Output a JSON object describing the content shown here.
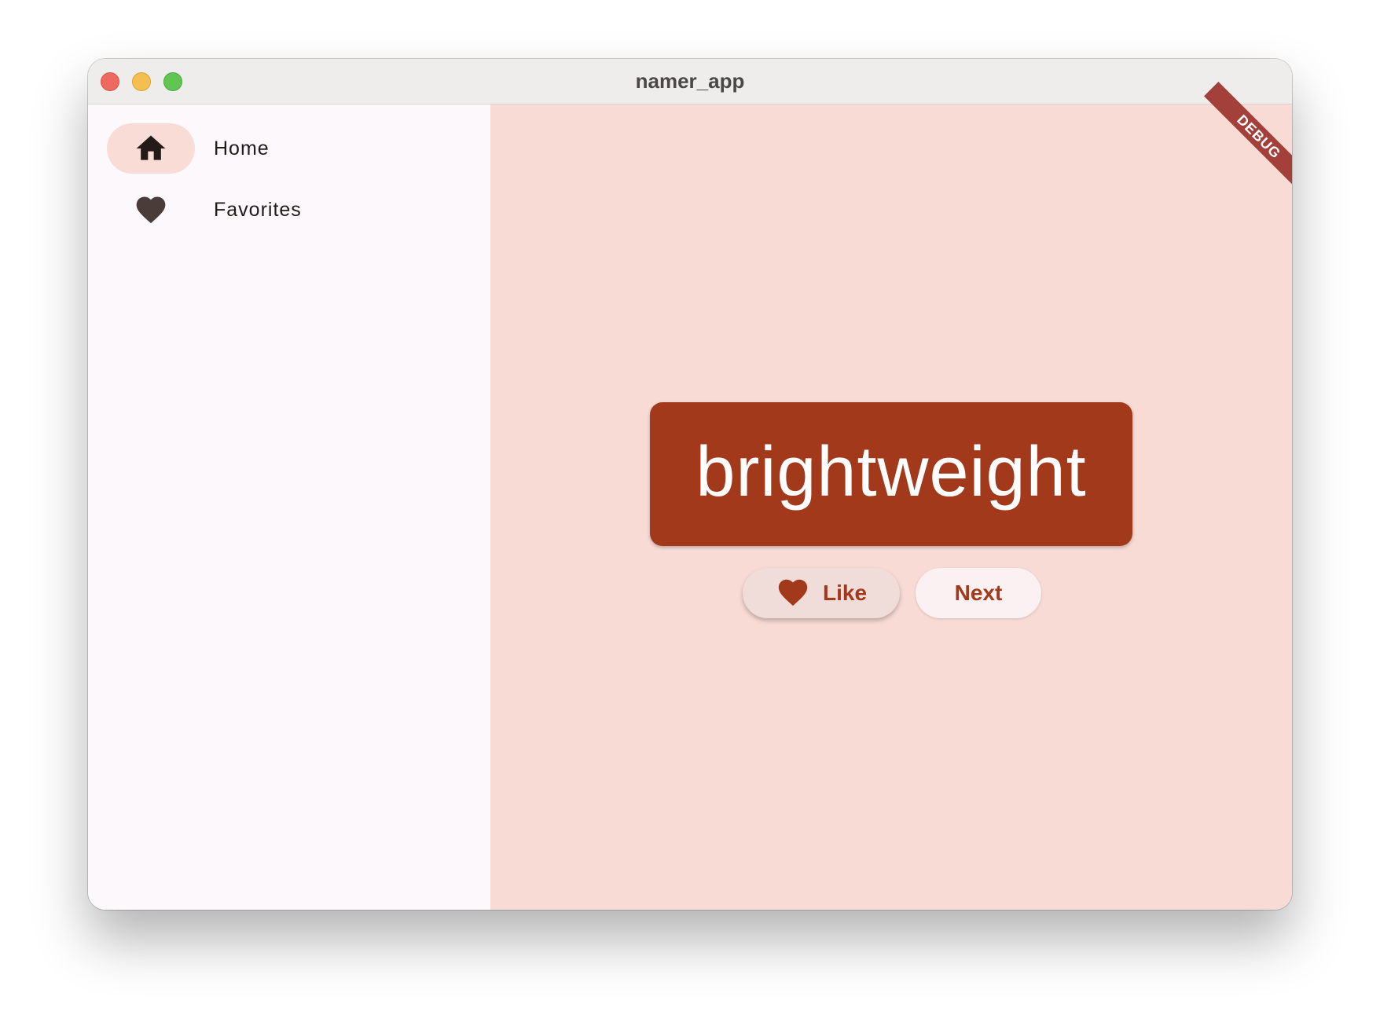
{
  "window": {
    "title": "namer_app"
  },
  "sidebar": {
    "items": [
      {
        "label": "Home",
        "icon": "home-icon",
        "selected": true
      },
      {
        "label": "Favorites",
        "icon": "heart-icon",
        "selected": false
      }
    ]
  },
  "main": {
    "debug_banner": "DEBUG",
    "word": "brightweight",
    "like_label": "Like",
    "next_label": "Next"
  },
  "colors": {
    "primary": "#a3391b",
    "main_background": "#f8dbd4",
    "sidebar_background": "#fdf8fb",
    "nav_indicator": "#f8dcd5",
    "debug_banner": "#a4403a"
  }
}
